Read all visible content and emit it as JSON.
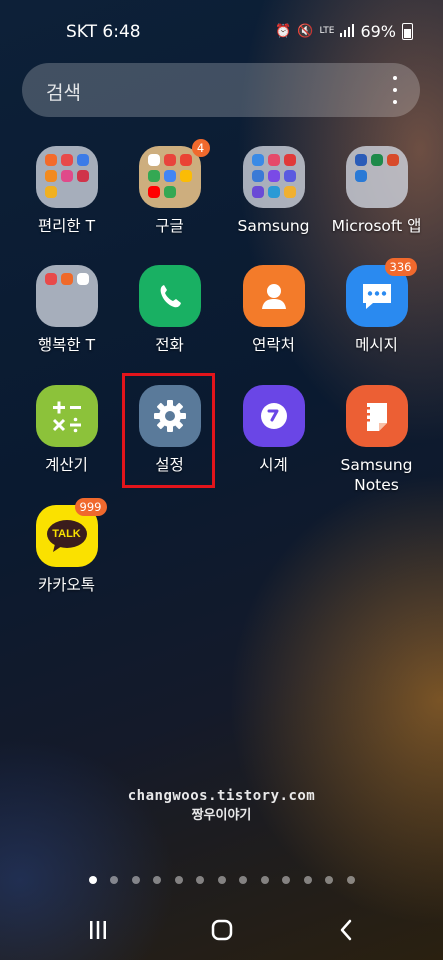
{
  "status_bar": {
    "carrier_time": "SKT 6:48",
    "network": "LTE",
    "battery_percent": "69%",
    "icons": [
      "alarm-icon",
      "mute-icon",
      "lte-icon",
      "signal-icon",
      "battery-icon"
    ]
  },
  "search": {
    "placeholder": "검색",
    "menu_icon": "more-vert-icon"
  },
  "apps": [
    {
      "id": "folder-pyeonrihan-t",
      "label": "편리한 T",
      "type": "folder",
      "badge": ""
    },
    {
      "id": "folder-google",
      "label": "구글",
      "type": "folder",
      "badge": "4"
    },
    {
      "id": "folder-samsung",
      "label": "Samsung",
      "type": "folder",
      "badge": ""
    },
    {
      "id": "folder-microsoft",
      "label": "Microsoft 앱",
      "type": "folder",
      "badge": ""
    },
    {
      "id": "folder-haengbokhan-t",
      "label": "행복한 T",
      "type": "folder",
      "badge": ""
    },
    {
      "id": "app-phone",
      "label": "전화",
      "type": "app",
      "icon": "phone-icon",
      "badge": ""
    },
    {
      "id": "app-contacts",
      "label": "연락처",
      "type": "app",
      "icon": "contact-person-icon",
      "badge": ""
    },
    {
      "id": "app-messages",
      "label": "메시지",
      "type": "app",
      "icon": "message-bubble-icon",
      "badge": "336"
    },
    {
      "id": "app-calculator",
      "label": "계산기",
      "type": "app",
      "icon": "calculator-icon",
      "badge": ""
    },
    {
      "id": "app-settings",
      "label": "설정",
      "type": "app",
      "icon": "gear-icon",
      "badge": "",
      "highlighted": true
    },
    {
      "id": "app-clock",
      "label": "시계",
      "type": "app",
      "icon": "clock-icon",
      "badge": ""
    },
    {
      "id": "app-samsung-notes",
      "label_line1": "Samsung",
      "label_line2": "Notes",
      "type": "app",
      "icon": "notes-icon",
      "badge": ""
    },
    {
      "id": "app-kakaotalk",
      "label": "카카오톡",
      "type": "app",
      "icon": "kakaotalk-icon",
      "icon_text": "TALK",
      "badge": "999"
    }
  ],
  "watermark": {
    "line1": "changwoos.tistory.com",
    "line2": "짱우이야기"
  },
  "pager": {
    "total": 13,
    "current": 1
  },
  "nav_bar": {
    "buttons": [
      "recents-icon",
      "home-icon",
      "back-icon"
    ]
  },
  "colors": {
    "highlight": "#e3141b",
    "badge": "#f0692d",
    "phone": "#19b063",
    "contacts": "#f37b2a",
    "messages": "#2a8af0",
    "calculator": "#8cc23a",
    "settings": "#5a7a9a",
    "clock": "#6a46e6",
    "notes": "#ec5f34",
    "kakaotalk": "#fae100"
  }
}
